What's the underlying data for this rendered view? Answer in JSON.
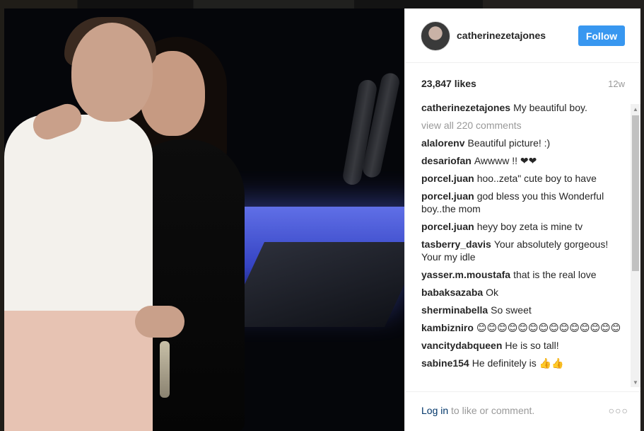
{
  "post": {
    "username": "catherinezetajones",
    "follow_label": "Follow",
    "likes": "23,847 likes",
    "age": "12w",
    "caption": {
      "user": "catherinezetajones",
      "text": "My beautiful boy."
    },
    "view_all": "view all 220 comments",
    "comments": [
      {
        "user": "alalorenv",
        "text": "Beautiful picture! :)"
      },
      {
        "user": "desariofan",
        "text": "Awwww !! ❤❤"
      },
      {
        "user": "porcel.juan",
        "text": "hoo..zeta\" cute boy to have"
      },
      {
        "user": "porcel.juan",
        "text": "god bless you this Wonderful boy..the mom"
      },
      {
        "user": "porcel.juan",
        "text": "heyy boy zeta is mine tv"
      },
      {
        "user": "tasberry_davis",
        "text": "Your absolutely gorgeous! Your my idle"
      },
      {
        "user": "yasser.m.moustafa",
        "text": "that is the real love"
      },
      {
        "user": "babaksazaba",
        "text": "Ok"
      },
      {
        "user": "sherminabella",
        "text": "So sweet"
      },
      {
        "user": "kambizniro",
        "text": "😊😊😊😊😊😊😊😊😊😊😊😊😊😊"
      },
      {
        "user": "vancitydabqueen",
        "text": "He is so tall!"
      },
      {
        "user": "sabine154",
        "text": "He definitely is 👍👍"
      }
    ],
    "footer": {
      "login_link": "Log in",
      "login_rest": " to like or comment.",
      "more": "○○○"
    }
  },
  "icons": {
    "more": "more-options-icon",
    "avatar": "profile-avatar"
  }
}
